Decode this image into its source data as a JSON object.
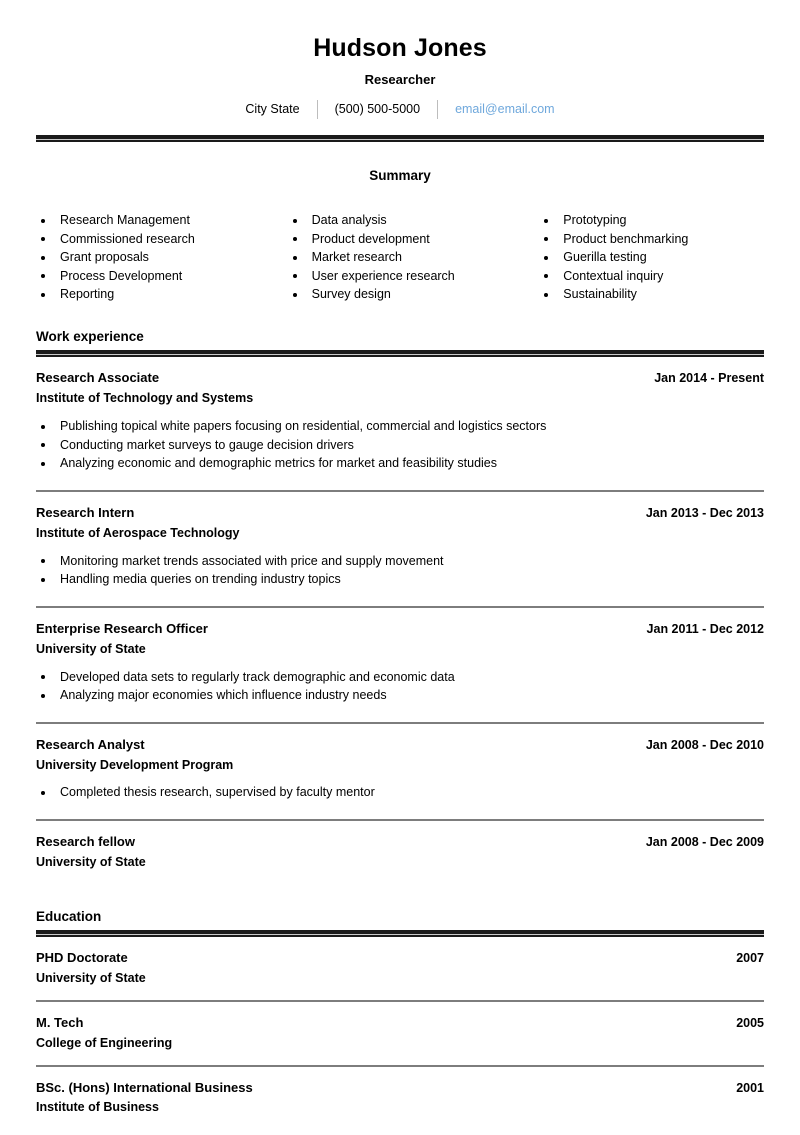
{
  "header": {
    "name": "Hudson Jones",
    "role": "Researcher",
    "location": "City State",
    "phone": "(500) 500-5000",
    "email": "email@email.com",
    "email_color": "#6fa8dc"
  },
  "summary": {
    "title": "Summary",
    "columns": [
      [
        "Research Management",
        "Commissioned research",
        "Grant proposals",
        "Process Development",
        "Reporting"
      ],
      [
        "Data analysis",
        "Product development",
        "Market research",
        "User experience research",
        "Survey design"
      ],
      [
        "Prototyping",
        "Product benchmarking",
        "Guerilla testing",
        "Contextual inquiry",
        "Sustainability"
      ]
    ]
  },
  "work": {
    "heading": "Work experience",
    "entries": [
      {
        "title": "Research Associate",
        "date": "Jan 2014 - Present",
        "org": "Institute of Technology and Systems",
        "points": [
          "Publishing topical white papers focusing on residential, commercial and logistics sectors",
          "Conducting market surveys to gauge decision drivers",
          "Analyzing economic and demographic metrics for market and feasibility studies"
        ]
      },
      {
        "title": "Research Intern",
        "date": "Jan 2013 - Dec 2013",
        "org": "Institute of Aerospace Technology",
        "points": [
          "Monitoring market trends associated with price and supply movement",
          "Handling media queries on trending industry  topics"
        ]
      },
      {
        "title": "Enterprise Research Officer",
        "date": "Jan 2011 - Dec 2012",
        "org": "University of State",
        "points": [
          "Developed data sets to regularly track demographic and economic data",
          "Analyzing major economies which influence industry needs"
        ]
      },
      {
        "title": "Research Analyst",
        "date": "Jan 2008 - Dec 2010",
        "org": "University Development Program",
        "points": [
          "Completed thesis research, supervised by faculty mentor"
        ]
      },
      {
        "title": "Research fellow",
        "date": "Jan 2008 - Dec 2009",
        "org": "University of State",
        "points": []
      }
    ]
  },
  "education": {
    "heading": "Education",
    "entries": [
      {
        "title": "PHD Doctorate",
        "date": "2007",
        "org": "University of State",
        "points": []
      },
      {
        "title": "M. Tech",
        "date": "2005",
        "org": "College of Engineering",
        "points": []
      },
      {
        "title": "BSc. (Hons) International Business",
        "date": "2001",
        "org": "Institute of Business",
        "points": []
      }
    ]
  }
}
